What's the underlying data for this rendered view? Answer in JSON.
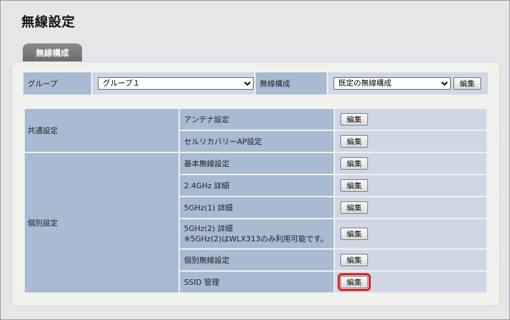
{
  "page": {
    "title": "無線設定"
  },
  "tab": {
    "label": "無線構成"
  },
  "top_row": {
    "group_label": "グループ",
    "group_value": "グループ１",
    "config_label": "無線構成",
    "config_value": "既定の無線構成",
    "edit_label": "編集"
  },
  "table": {
    "edit_label": "編集",
    "categories": [
      {
        "name": "共通設定",
        "rows": [
          "アンテナ設定",
          "セルリカバリーAP設定"
        ]
      },
      {
        "name": "個別設定",
        "rows": [
          "基本無線設定",
          "2.4GHz 詳細",
          "5GHz(1) 詳細",
          "5GHz(2) 詳細",
          "個別無線設定",
          "SSID 管理"
        ]
      }
    ],
    "note_5ghz2": "※5GHz(2)はWLX313のみ利用可能です。"
  },
  "highlight": {
    "color": "#e51b1b",
    "target": "SSID 管理"
  }
}
